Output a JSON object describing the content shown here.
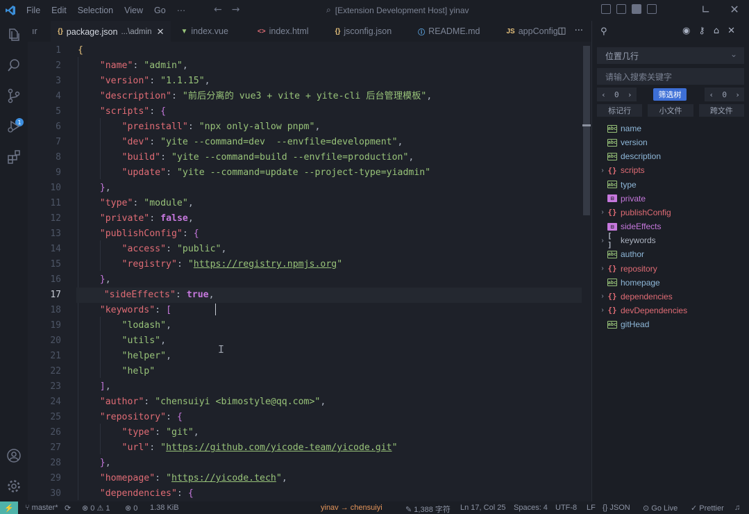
{
  "titlebar": {
    "menu": [
      "File",
      "Edit",
      "Selection",
      "View",
      "Go",
      "···"
    ],
    "title": "[Extension Development Host] yinav"
  },
  "tabs": [
    {
      "icon": "{}",
      "label": "package.json",
      "sublabel": "...\\admin",
      "active": true,
      "color": "#e5c07b"
    },
    {
      "icon": "▼",
      "label": "index.vue",
      "color": "#98c379"
    },
    {
      "icon": "<>",
      "label": "index.html",
      "color": "#e06c75"
    },
    {
      "icon": "{}",
      "label": "jsconfig.json",
      "color": "#e5c07b"
    },
    {
      "icon": "ⓘ",
      "label": "README.md",
      "color": "#61afef"
    },
    {
      "icon": "JS",
      "label": "appConfig.",
      "color": "#e5c07b"
    }
  ],
  "tab_scroll_hint": "ır",
  "editor": {
    "line_numbers": [
      "1",
      "2",
      "3",
      "4",
      "5",
      "6",
      "7",
      "8",
      "9",
      "10",
      "11",
      "12",
      "13",
      "14",
      "15",
      "16",
      "17",
      "18",
      "19",
      "20",
      "21",
      "22",
      "23",
      "24",
      "25",
      "26",
      "27",
      "28",
      "29",
      "30"
    ],
    "current_line": "17"
  },
  "code": {
    "l1": "{",
    "l2_k": "\"name\"",
    "l2_v": "\"admin\"",
    "l3_k": "\"version\"",
    "l3_v": "\"1.1.15\"",
    "l4_k": "\"description\"",
    "l4_v": "\"前后分离的 vue3 + vite + yite-cli 后台管理模板\"",
    "l5_k": "\"scripts\"",
    "l6_k": "\"preinstall\"",
    "l6_v": "\"npx only-allow pnpm\"",
    "l7_k": "\"dev\"",
    "l7_v": "\"yite --command=dev  --envfile=development\"",
    "l8_k": "\"build\"",
    "l8_v": "\"yite --command=build --envfile=production\"",
    "l9_k": "\"update\"",
    "l9_v": "\"yite --command=update --project-type=yiadmin\"",
    "l11_k": "\"type\"",
    "l11_v": "\"module\"",
    "l12_k": "\"private\"",
    "l12_v": "false",
    "l13_k": "\"publishConfig\"",
    "l14_k": "\"access\"",
    "l14_v": "\"public\"",
    "l15_k": "\"registry\"",
    "l15_v": "https://registry.npmjs.org",
    "l17_k": "\"sideEffects\"",
    "l17_v": "true",
    "l18_k": "\"keywords\"",
    "l19_v": "\"lodash\"",
    "l20_v": "\"utils\"",
    "l21_v": "\"helper\"",
    "l22_v": "\"help\"",
    "l24_k": "\"author\"",
    "l24_v": "\"chensuiyi <bimostyle@qq.com>\"",
    "l25_k": "\"repository\"",
    "l26_k": "\"type\"",
    "l26_v": "\"git\"",
    "l27_k": "\"url\"",
    "l27_v": "https://github.com/yicode-team/yicode.git",
    "l29_k": "\"homepage\"",
    "l29_v": "https://yicode.tech",
    "l30_k": "\"dependencies\""
  },
  "panel": {
    "location_select": "位置几行",
    "search_placeholder": "请输入搜索关键字",
    "stepper_left": "0",
    "stepper_right": "0",
    "filter_button": "筛选树",
    "buttons": [
      "标记行",
      "小文件",
      "跨文件"
    ],
    "tree": [
      {
        "label": "name",
        "type": "str",
        "expandable": false
      },
      {
        "label": "version",
        "type": "str",
        "expandable": false
      },
      {
        "label": "description",
        "type": "str",
        "expandable": false
      },
      {
        "label": "scripts",
        "type": "obj",
        "expandable": true
      },
      {
        "label": "type",
        "type": "str",
        "expandable": false
      },
      {
        "label": "private",
        "type": "bool",
        "expandable": false
      },
      {
        "label": "publishConfig",
        "type": "obj",
        "expandable": true
      },
      {
        "label": "sideEffects",
        "type": "bool",
        "expandable": false
      },
      {
        "label": "keywords",
        "type": "arr",
        "expandable": true
      },
      {
        "label": "author",
        "type": "str",
        "expandable": false
      },
      {
        "label": "repository",
        "type": "obj",
        "expandable": true
      },
      {
        "label": "homepage",
        "type": "str",
        "expandable": false
      },
      {
        "label": "dependencies",
        "type": "obj",
        "expandable": true
      },
      {
        "label": "devDependencies",
        "type": "obj",
        "expandable": true
      },
      {
        "label": "gitHead",
        "type": "str",
        "expandable": false
      }
    ]
  },
  "status": {
    "remote": "⚡",
    "branch": "master*",
    "problems": "⊗ 0 ⚠ 1",
    "ports": "⊗ 0",
    "size": "1.38 KiB",
    "user": "yinav → chensuiyi",
    "chars": "1,388 字符",
    "position": "Ln 17, Col 25",
    "spaces": "Spaces: 4",
    "encoding": "UTF-8",
    "eol": "LF",
    "language": "{} JSON",
    "golive": "Go Live",
    "prettier": "✓ Prettier"
  },
  "colors": {
    "accent": "#3d6fd6",
    "remote": "#4fb3a9",
    "key": "#e06c75",
    "string": "#98c379",
    "boolean": "#c678dd"
  }
}
